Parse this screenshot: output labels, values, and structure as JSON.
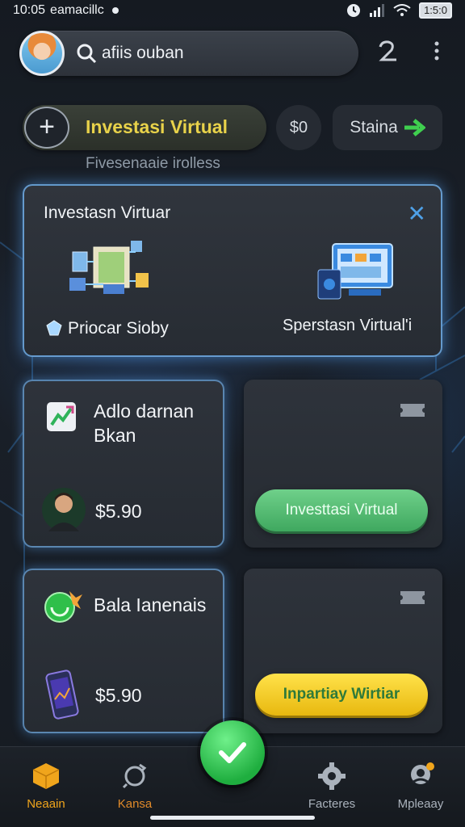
{
  "status_bar": {
    "time": "10:05",
    "carrier": "eamacillc",
    "battery": "1:5:0"
  },
  "search": {
    "text": "afiis ouban"
  },
  "actions": {
    "invest_label": "Investasi Virtual",
    "balance": "$0",
    "staina_label": "Staina"
  },
  "subtitle": "Fivesenaaie irolless",
  "feature_card": {
    "title": "Investasn Virtuar",
    "left_label": "Priocar Sioby",
    "right_label": "Sperstasn Virtual'i"
  },
  "cards": [
    {
      "title_line1": "Adlo darnan",
      "title_line2": "Bkan",
      "price": "$5.90"
    },
    {
      "button": "Investtasi Virtual"
    },
    {
      "title": "Bala Ianenais",
      "price": "$5.90"
    },
    {
      "button": "Inpartiay Wirtiar"
    }
  ],
  "nav": [
    {
      "label": "Neaain",
      "color": "#f0a51c"
    },
    {
      "label": "Kansa",
      "color": "#e08a2a"
    },
    {
      "label": "Facteres",
      "color": "#aab2bc"
    },
    {
      "label": "Mpleaay",
      "color": "#aab2bc"
    }
  ],
  "colors": {
    "accent_blue": "#4ea1e8",
    "accent_green": "#3fa85f",
    "accent_yellow": "#e8d24a"
  }
}
